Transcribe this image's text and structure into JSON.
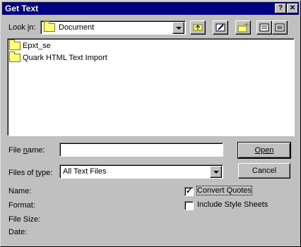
{
  "window": {
    "title": "Get Text",
    "help_label": "?",
    "close_label": "✕"
  },
  "lookin": {
    "label": "Look in:",
    "value": "Document"
  },
  "toolbar": {
    "icons": [
      "up-one-level-icon",
      "desktop-icon",
      "new-folder-icon",
      "list-view-icon",
      "details-view-icon"
    ]
  },
  "files": [
    {
      "name": "Epxt_se",
      "icon": "folder-icon"
    },
    {
      "name": "Quark HTML Text Import",
      "icon": "folder-icon"
    }
  ],
  "filename": {
    "label": "File name:",
    "value": ""
  },
  "filetype": {
    "label": "Files of type:",
    "value": "All Text Files"
  },
  "buttons": {
    "open": "Open",
    "cancel": "Cancel"
  },
  "info": {
    "name": "Name:",
    "format": "Format:",
    "size": "File Size:",
    "date": "Date:"
  },
  "options": {
    "convert_quotes": {
      "label": "Convert Quotes",
      "checked": true
    },
    "include_style": {
      "label": "Include Style Sheets",
      "checked": false
    }
  }
}
